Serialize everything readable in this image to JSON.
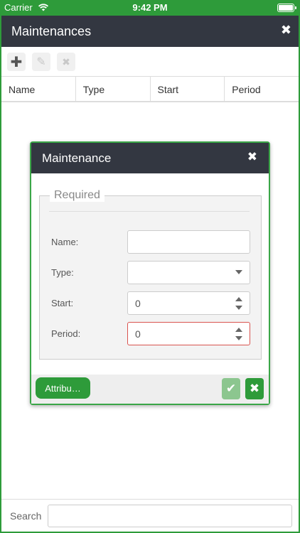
{
  "status_bar": {
    "carrier": "Carrier",
    "time": "9:42 PM"
  },
  "window": {
    "title": "Maintenances",
    "toolbar": {
      "add_icon": "plus-icon",
      "edit_icon": "pencil-icon",
      "delete_icon": "close-icon"
    },
    "columns": [
      "Name",
      "Type",
      "Start",
      "Period"
    ],
    "search": {
      "label": "Search",
      "value": ""
    }
  },
  "dialog": {
    "title": "Maintenance",
    "section": "Required",
    "fields": {
      "name": {
        "label": "Name:",
        "value": ""
      },
      "type": {
        "label": "Type:",
        "value": ""
      },
      "start": {
        "label": "Start:",
        "value": "0"
      },
      "period": {
        "label": "Period:",
        "value": "0"
      }
    },
    "footer": {
      "attributes_label": "Attribu…"
    }
  },
  "colors": {
    "accent": "#2e9b3a",
    "header": "#333741",
    "invalid": "#d9534f"
  }
}
